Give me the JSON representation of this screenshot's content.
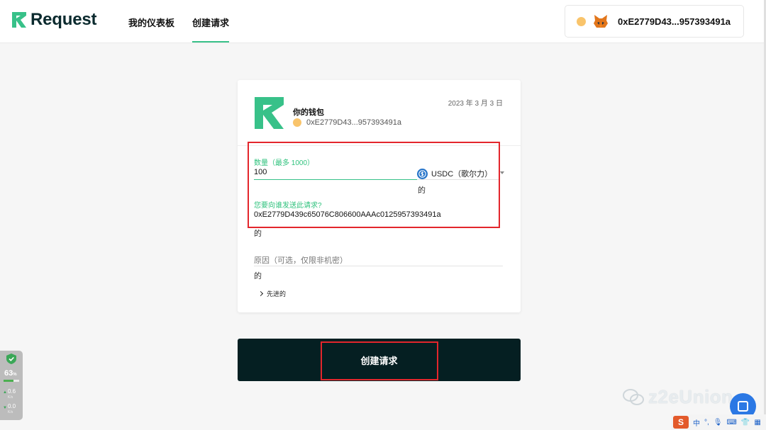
{
  "brand": {
    "name": "Request"
  },
  "nav": [
    {
      "label": "我的仪表板"
    },
    {
      "label": "创建请求"
    }
  ],
  "wallet": {
    "address": "0xE2779D43...957393491a"
  },
  "card": {
    "date": "2023 年 3 月 3 日",
    "title": "你的钱包",
    "address": "0xE2779D43...957393491a",
    "amount_label": "数量（最多 1000）",
    "amount_value": "100",
    "currency": "USDC（歌尔力）",
    "amount_suffix": "的",
    "recipient_label": "您要向谁发送此请求?",
    "recipient_value": "0xE2779D439c65076C806600AAAc0125957393491a",
    "recipient_suffix": "的",
    "reason_placeholder": "原因（可选，仅限非机密）",
    "reason_suffix": "的",
    "advanced_label": "先进的"
  },
  "submit": {
    "label": "创建请求"
  },
  "system_widget": {
    "percent": "63",
    "percent_unit": "%",
    "up_speed": "0.6",
    "down_speed": "0.0",
    "speed_unit": "K/s"
  },
  "watermark": {
    "text": "z2eUnion"
  },
  "ime": {
    "mode": "中",
    "punct": "°,"
  },
  "colors": {
    "accent": "#38c189",
    "dark_button": "#051f22",
    "annotation_red": "#e3262c"
  }
}
